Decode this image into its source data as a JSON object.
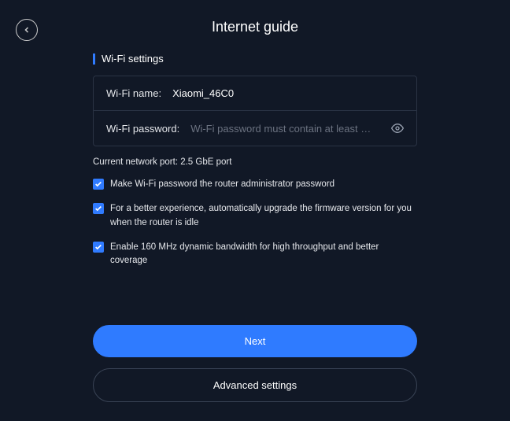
{
  "header": {
    "title": "Internet guide"
  },
  "section": {
    "title": "Wi-Fi settings"
  },
  "fields": {
    "name_label": "Wi-Fi name:",
    "name_value": "Xiaomi_46C0",
    "password_label": "Wi-Fi password:",
    "password_placeholder": "Wi-Fi password must contain at least …"
  },
  "port_info": "Current network port: 2.5 GbE port",
  "options": {
    "opt1": "Make Wi-Fi password the router administrator password",
    "opt2": "For a better experience, automatically upgrade the firmware version for you when the router is idle",
    "opt3": "Enable 160 MHz dynamic bandwidth for high throughput and better coverage"
  },
  "buttons": {
    "next": "Next",
    "advanced": "Advanced settings"
  }
}
